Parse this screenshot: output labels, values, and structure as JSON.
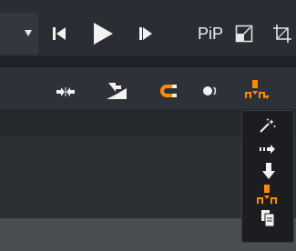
{
  "transport": {
    "pip_label": "PiP"
  },
  "icons": {
    "dropdown": "chevron-down-icon",
    "prev_frame": "skip-back-icon",
    "play": "play-icon",
    "next_frame": "skip-forward-icon",
    "resize": "resize-corner-icon",
    "crop": "crop-icon",
    "split": "split-clip-icon",
    "insert": "insert-clip-icon",
    "magnet": "magnet-snap-icon",
    "audio": "audio-scrub-icon",
    "edit_mode": "edit-mode-dropdown-icon"
  },
  "edit_mode_menu": {
    "items": [
      "magic-wand-icon",
      "ripple-right-icon",
      "drop-down-arrow-icon",
      "overwrite-mode-icon",
      "paste-document-icon"
    ]
  },
  "colors": {
    "accent": "#ff8a00",
    "icon": "#f2f2f2",
    "background": "#2b2d31"
  }
}
